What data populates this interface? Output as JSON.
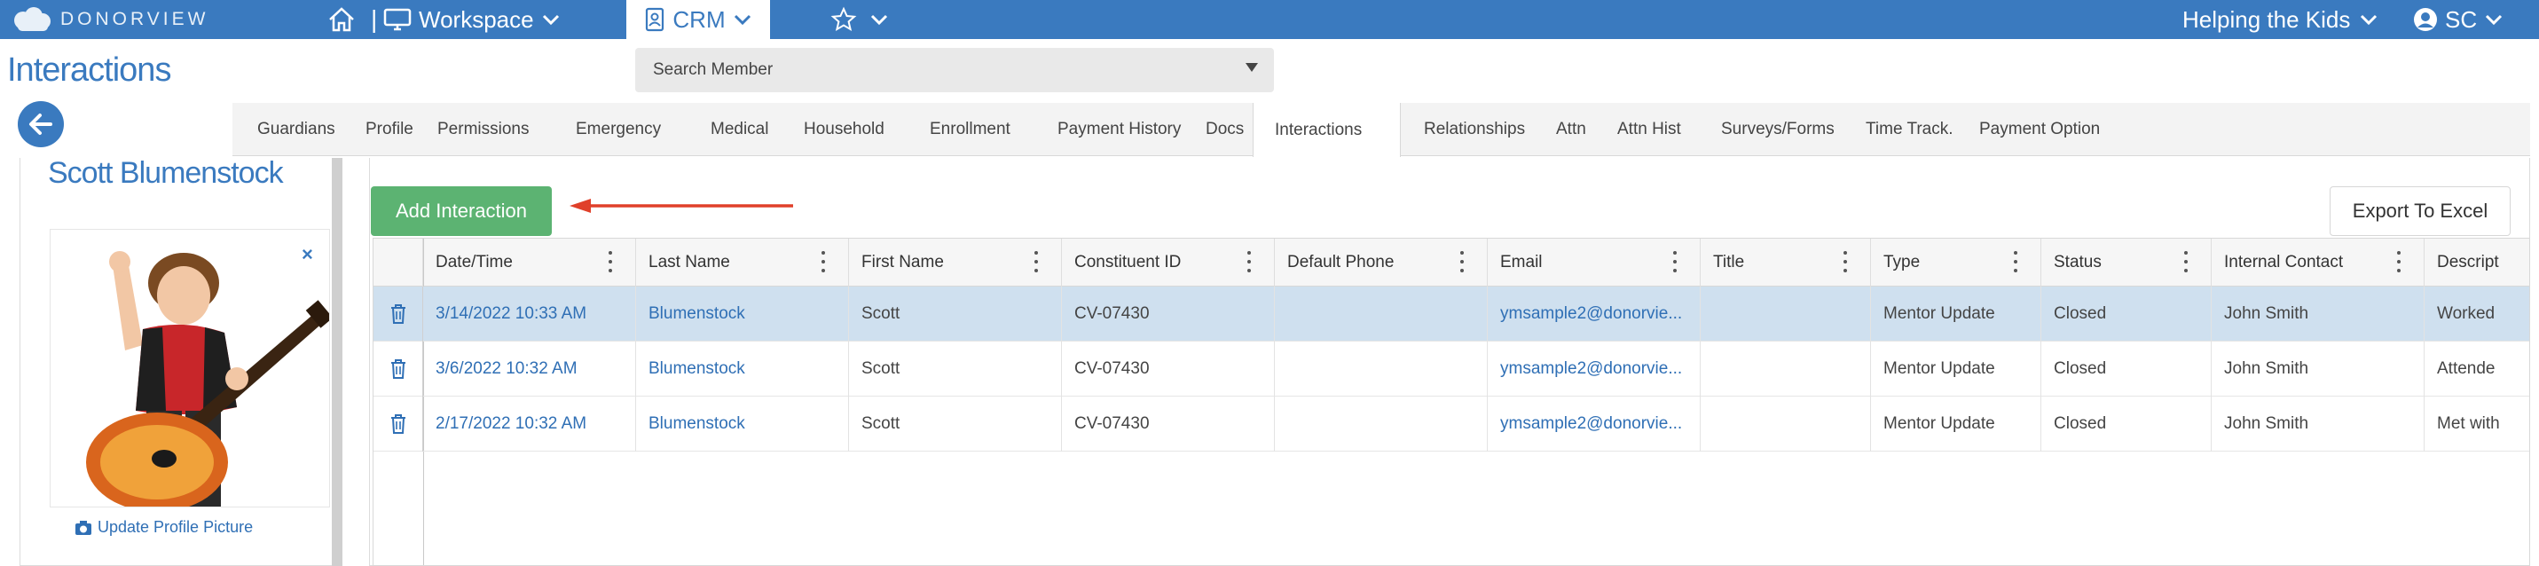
{
  "brand": {
    "logo_text": "DONORVIEW",
    "accent": "#3a7abf",
    "add_button_color": "#5cb372"
  },
  "topnav": {
    "workspace_label": "Workspace",
    "crm_label": "CRM",
    "organization": "Helping the Kids",
    "user_initials": "SC"
  },
  "page": {
    "title": "Interactions"
  },
  "search": {
    "placeholder": "Search Member"
  },
  "tabs": [
    {
      "label": "Guardians"
    },
    {
      "label": "Profile"
    },
    {
      "label": "Permissions"
    },
    {
      "label": "Emergency"
    },
    {
      "label": "Medical"
    },
    {
      "label": "Household"
    },
    {
      "label": "Enrollment"
    },
    {
      "label": "Payment History"
    },
    {
      "label": "Docs"
    },
    {
      "label": "Interactions",
      "active": true
    },
    {
      "label": "Relationships"
    },
    {
      "label": "Attn"
    },
    {
      "label": "Attn Hist"
    },
    {
      "label": "Surveys/Forms"
    },
    {
      "label": "Time Track."
    },
    {
      "label": "Payment Option"
    }
  ],
  "member": {
    "name": "Scott Blumenstock",
    "update_picture_label": "Update Profile Picture",
    "close_symbol": "×"
  },
  "actions": {
    "add_interaction": "Add Interaction",
    "export_excel": "Export To Excel"
  },
  "grid": {
    "columns": [
      "Date/Time",
      "Last Name",
      "First Name",
      "Constituent ID",
      "Default Phone",
      "Email",
      "Title",
      "Type",
      "Status",
      "Internal Contact",
      "Descript"
    ],
    "rows": [
      {
        "selected": true,
        "cells": [
          "3/14/2022 10:33 AM",
          "Blumenstock",
          "Scott",
          "CV-07430",
          "",
          "ymsample2@donorvie...",
          "",
          "Mentor Update",
          "Closed",
          "John Smith",
          "Worked"
        ]
      },
      {
        "selected": false,
        "cells": [
          "3/6/2022 10:32 AM",
          "Blumenstock",
          "Scott",
          "CV-07430",
          "",
          "ymsample2@donorvie...",
          "",
          "Mentor Update",
          "Closed",
          "John Smith",
          "Attende"
        ]
      },
      {
        "selected": false,
        "cells": [
          "2/17/2022 10:32 AM",
          "Blumenstock",
          "Scott",
          "CV-07430",
          "",
          "ymsample2@donorvie...",
          "",
          "Mentor Update",
          "Closed",
          "John Smith",
          "Met with"
        ]
      }
    ]
  }
}
